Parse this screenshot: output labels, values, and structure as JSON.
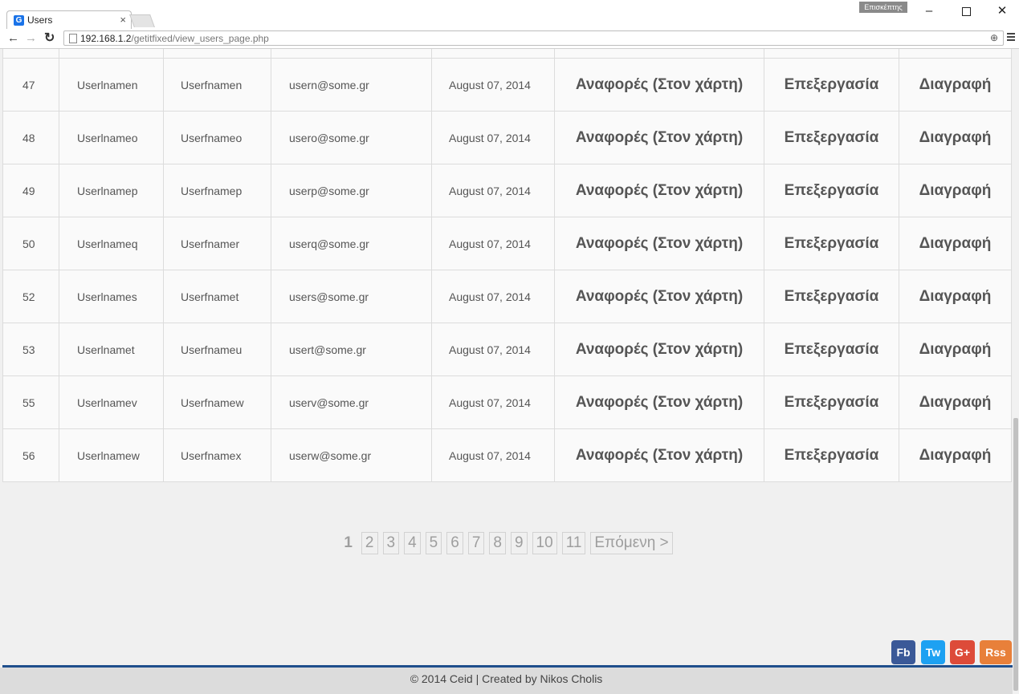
{
  "browser": {
    "tab_title": "Users",
    "tab_close": "×",
    "tab_favicon": "G",
    "profile_label": "Επισκέπτης",
    "url_host": "192.168.1.2",
    "url_path": "/getitfixed/view_users_page.php"
  },
  "table": {
    "rows": [
      {
        "id": "47",
        "username": "Userlnamen",
        "firstname": "Userfnamen",
        "email": "usern@some.gr",
        "date": "August 07, 2014"
      },
      {
        "id": "48",
        "username": "Userlnameo",
        "firstname": "Userfnameo",
        "email": "usero@some.gr",
        "date": "August 07, 2014"
      },
      {
        "id": "49",
        "username": "Userlnamep",
        "firstname": "Userfnamep",
        "email": "userp@some.gr",
        "date": "August 07, 2014"
      },
      {
        "id": "50",
        "username": "Userlnameq",
        "firstname": "Userfnamer",
        "email": "userq@some.gr",
        "date": "August 07, 2014"
      },
      {
        "id": "52",
        "username": "Userlnames",
        "firstname": "Userfnamet",
        "email": "users@some.gr",
        "date": "August 07, 2014"
      },
      {
        "id": "53",
        "username": "Userlnamet",
        "firstname": "Userfnameu",
        "email": "usert@some.gr",
        "date": "August 07, 2014"
      },
      {
        "id": "55",
        "username": "Userlnamev",
        "firstname": "Userfnamew",
        "email": "userv@some.gr",
        "date": "August 07, 2014"
      },
      {
        "id": "56",
        "username": "Userlnamew",
        "firstname": "Userfnamex",
        "email": "userw@some.gr",
        "date": "August 07, 2014"
      }
    ],
    "actions": {
      "map": "Αναφορές (Στον χάρτη)",
      "edit": "Επεξεργασία",
      "delete": "Διαγραφή"
    }
  },
  "pagination": {
    "current": "1",
    "pages": [
      "2",
      "3",
      "4",
      "5",
      "6",
      "7",
      "8",
      "9",
      "10",
      "11"
    ],
    "next": "Επόμενη >"
  },
  "social": {
    "fb": "Fb",
    "tw": "Tw",
    "gplus": "G+",
    "rss": "Rss"
  },
  "footer": {
    "text": "© 2014 Ceid | Created by Nikos Cholis"
  },
  "colors": {
    "footer_line": "#1f4e8c",
    "fb": "#3b5998",
    "tw": "#1da1f2",
    "gplus": "#dd4b39",
    "rss": "#e8803a"
  }
}
